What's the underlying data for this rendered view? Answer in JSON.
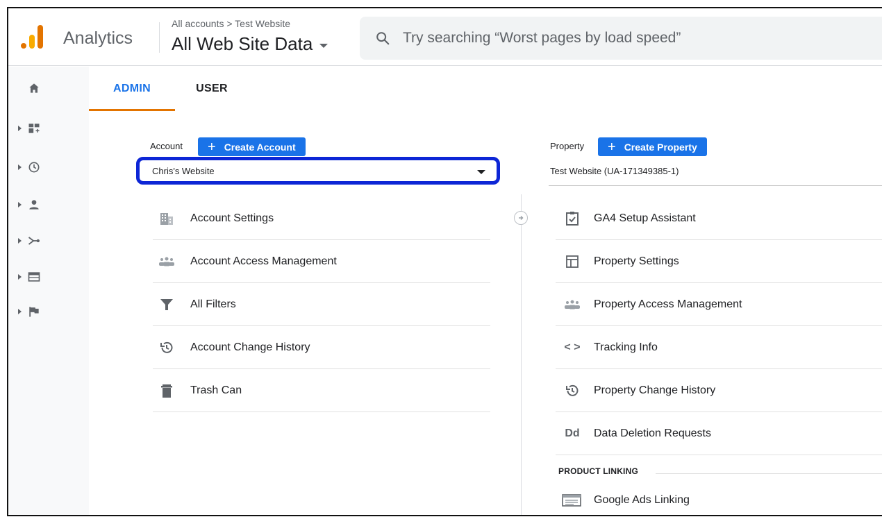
{
  "header": {
    "app_name": "Analytics",
    "breadcrumb": "All accounts > Test Website",
    "view_name": "All Web Site Data",
    "search_placeholder": "Try searching “Worst pages by load speed”"
  },
  "tabs": [
    {
      "label": "ADMIN",
      "active": true
    },
    {
      "label": "USER",
      "active": false
    }
  ],
  "account": {
    "label": "Account",
    "create_button": "Create Account",
    "selected": "Chris's Website",
    "menu": [
      {
        "label": "Account Settings",
        "icon": "building-icon"
      },
      {
        "label": "Account Access Management",
        "icon": "people-icon"
      },
      {
        "label": "All Filters",
        "icon": "filter-icon"
      },
      {
        "label": "Account Change History",
        "icon": "history-icon"
      },
      {
        "label": "Trash Can",
        "icon": "trash-icon"
      }
    ]
  },
  "property": {
    "label": "Property",
    "create_button": "Create Property",
    "selected": "Test Website (UA-171349385-1)",
    "menu": [
      {
        "label": "GA4 Setup Assistant",
        "icon": "checklist-icon"
      },
      {
        "label": "Property Settings",
        "icon": "layout-icon"
      },
      {
        "label": "Property Access Management",
        "icon": "people-icon"
      },
      {
        "label": "Tracking Info",
        "icon": "code-icon",
        "glyph": "< >"
      },
      {
        "label": "Property Change History",
        "icon": "history-icon"
      },
      {
        "label": "Data Deletion Requests",
        "icon": "data-deletion-icon",
        "glyph": "Dd"
      }
    ],
    "section_heading": "PRODUCT LINKING",
    "linking": [
      {
        "label": "Google Ads Linking",
        "icon": "ads-icon"
      }
    ]
  },
  "colors": {
    "accent_blue": "#1a73e8",
    "tab_underline": "#e37400",
    "highlight_outline": "#0d26d6"
  }
}
